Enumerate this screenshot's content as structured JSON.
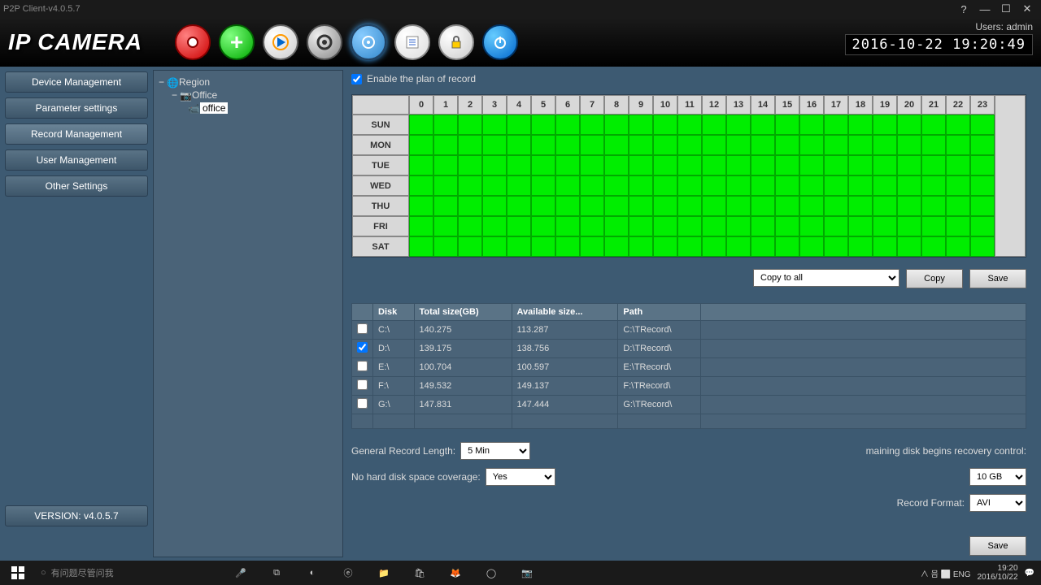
{
  "window": {
    "title": "P2P Client-v4.0.5.7"
  },
  "header": {
    "logo": "IP CAMERA",
    "user_label": "Users: admin",
    "datetime": "2016-10-22 19:20:49"
  },
  "sidebar": {
    "items": [
      "Device Management",
      "Parameter settings",
      "Record Management",
      "User Management",
      "Other Settings"
    ],
    "version": "VERSION: v4.0.5.7"
  },
  "tree": {
    "root": "Region",
    "child1": "Office",
    "child2": "office"
  },
  "record": {
    "enable_label": "Enable the plan of record",
    "days": [
      "SUN",
      "MON",
      "TUE",
      "WED",
      "THU",
      "FRI",
      "SAT"
    ],
    "hours": [
      "0",
      "1",
      "2",
      "3",
      "4",
      "5",
      "6",
      "7",
      "8",
      "9",
      "10",
      "11",
      "12",
      "13",
      "14",
      "15",
      "16",
      "17",
      "18",
      "19",
      "20",
      "21",
      "22",
      "23"
    ],
    "copy_select": "Copy to all",
    "copy_btn": "Copy",
    "save_btn": "Save"
  },
  "disks": {
    "headers": [
      "Disk",
      "Total size(GB)",
      "Available size...",
      "Path"
    ],
    "rows": [
      {
        "chk": false,
        "disk": "C:\\",
        "total": "140.275",
        "avail": "113.287",
        "path": "C:\\TRecord\\"
      },
      {
        "chk": true,
        "disk": "D:\\",
        "total": "139.175",
        "avail": "138.756",
        "path": "D:\\TRecord\\"
      },
      {
        "chk": false,
        "disk": "E:\\",
        "total": "100.704",
        "avail": "100.597",
        "path": "E:\\TRecord\\"
      },
      {
        "chk": false,
        "disk": "F:\\",
        "total": "149.532",
        "avail": "149.137",
        "path": "F:\\TRecord\\"
      },
      {
        "chk": false,
        "disk": "G:\\",
        "total": "147.831",
        "avail": "147.444",
        "path": "G:\\TRecord\\"
      }
    ]
  },
  "options": {
    "gen_len_label": "General Record Length:",
    "gen_len_value": "5 Min",
    "recovery_label": "maining disk begins recovery control:",
    "recovery_value": "10 GB",
    "coverage_label": "No hard disk space coverage:",
    "coverage_value": "Yes",
    "format_label": "Record Format:",
    "format_value": "AVI",
    "save_btn": "Save"
  },
  "taskbar": {
    "search_placeholder": "有问题尽管问我",
    "tray": "∧ 믐 ⬜ ENG",
    "time": "19:20",
    "date": "2016/10/22"
  }
}
